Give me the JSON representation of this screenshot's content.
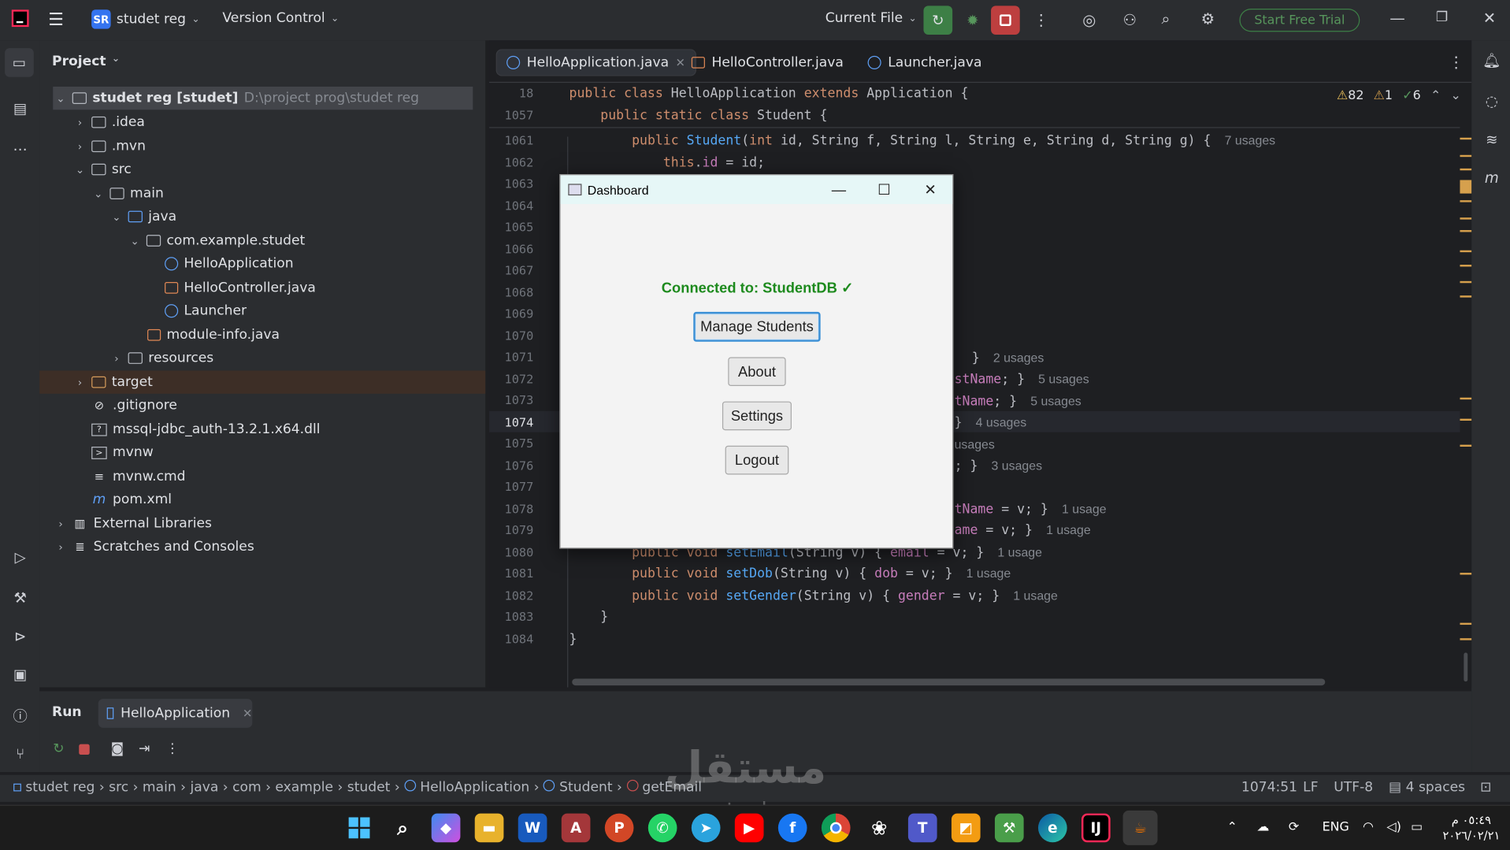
{
  "titlebar": {
    "project_badge": "SR",
    "project_name": "studet reg",
    "version_control": "Version Control",
    "run_config": "Current File",
    "trial_button": "Start Free Trial"
  },
  "project_panel": {
    "title": "Project",
    "root": {
      "name": "studet reg [studet]",
      "path": "D:\\project prog\\studet reg"
    },
    "items": [
      ".idea",
      ".mvn",
      "src",
      "main",
      "java",
      "com.example.studet",
      "HelloApplication",
      "HelloController.java",
      "Launcher",
      "module-info.java",
      "resources",
      "target",
      ".gitignore",
      "mssql-jdbc_auth-13.2.1.x64.dll",
      "mvnw",
      "mvnw.cmd",
      "pom.xml",
      "External Libraries",
      "Scratches and Consoles"
    ]
  },
  "editor": {
    "tabs": [
      "HelloApplication.java",
      "HelloController.java",
      "Launcher.java"
    ],
    "inspections": {
      "warnings": "82",
      "weak_warnings": "1",
      "ok": "6"
    },
    "line_numbers": [
      "18",
      "1057",
      "1061",
      "1062",
      "1063",
      "1064",
      "1065",
      "1066",
      "1067",
      "1068",
      "1069",
      "1070",
      "1071",
      "1072",
      "1073",
      "1074",
      "1075",
      "1076",
      "1077",
      "1078",
      "1079",
      "1080",
      "1081",
      "1082",
      "1083",
      "1084"
    ],
    "hints": {
      "h1061": "7 usages",
      "h1071": "2 usages",
      "h1072": "5 usages",
      "h1073": "5 usages",
      "h1074": "4 usages",
      "h1075": "usages",
      "h1076": "3 usages",
      "h1078": "1 usage",
      "h1079": "1 usage",
      "h1080": "1 usage",
      "h1081": "1 usage",
      "h1082": "1 usage"
    }
  },
  "dialog": {
    "title": "Dashboard",
    "status": "Connected to: StudentDB ✓",
    "buttons": [
      "Manage Students",
      "About",
      "Settings",
      "Logout"
    ]
  },
  "run_panel": {
    "label": "Run",
    "tab": "HelloApplication"
  },
  "statusbar": {
    "crumbs": [
      "studet reg",
      "src",
      "main",
      "java",
      "com",
      "example",
      "studet",
      "HelloApplication",
      "Student",
      "getEmail"
    ],
    "position": "1074:51",
    "line_sep": "LF",
    "encoding": "UTF-8",
    "indent": "4 spaces"
  },
  "watermark": {
    "arabic": "مستقل",
    "latin": "mostaql.com"
  },
  "taskbar": {
    "lang": "ENG",
    "time": "٠٥:٤٩ م",
    "date": "٢٠٢٦/٠٢/٢١"
  }
}
